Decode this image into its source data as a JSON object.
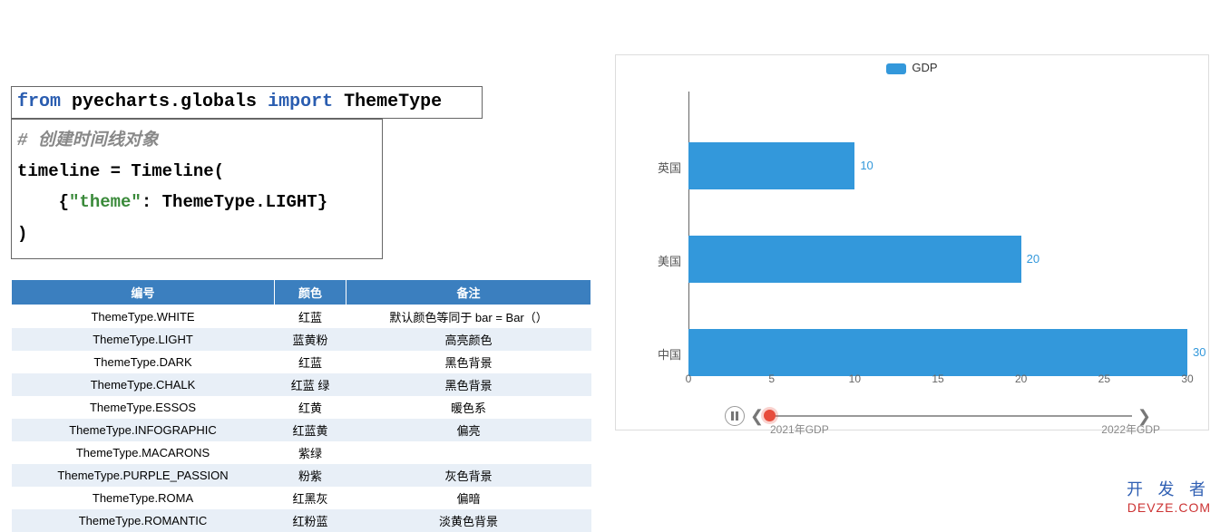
{
  "code1": {
    "kw_from": "from",
    "mod": " pyecharts.globals ",
    "kw_import": "import",
    "cls": " ThemeType"
  },
  "code2": {
    "comment": "# 创建时间线对象",
    "line1": "timeline = Timeline(",
    "indent": "    ",
    "brace_open": "{",
    "theme_key": "\"theme\"",
    "colon": ": ThemeType.LIGHT",
    "brace_close": "}",
    "line3": ")"
  },
  "table": {
    "headers": [
      "编号",
      "颜色",
      "备注"
    ],
    "rows": [
      [
        "ThemeType.WHITE",
        "红蓝",
        "默认颜色等同于 bar = Bar（）"
      ],
      [
        "ThemeType.LIGHT",
        "蓝黄粉",
        "高亮颜色"
      ],
      [
        "ThemeType.DARK",
        "红蓝",
        "黑色背景"
      ],
      [
        "ThemeType.CHALK",
        "红蓝 绿",
        "黑色背景"
      ],
      [
        "ThemeType.ESSOS",
        "红黄",
        "暖色系"
      ],
      [
        "ThemeType.INFOGRAPHIC",
        "红蓝黄",
        "偏亮"
      ],
      [
        "ThemeType.MACARONS",
        "紫绿",
        ""
      ],
      [
        "ThemeType.PURPLE_PASSION",
        "粉紫",
        "灰色背景"
      ],
      [
        "ThemeType.ROMA",
        "红黑灰",
        "偏暗"
      ],
      [
        "ThemeType.ROMANTIC",
        "红粉蓝",
        "淡黄色背景"
      ]
    ]
  },
  "chart_data": {
    "type": "bar",
    "orientation": "horizontal",
    "categories": [
      "英国",
      "美国",
      "中国"
    ],
    "series": [
      {
        "name": "GDP",
        "values": [
          10,
          20,
          30
        ]
      }
    ],
    "xlabel": "",
    "ylabel": "",
    "xlim": [
      0,
      30
    ],
    "x_ticks": [
      0,
      5,
      10,
      15,
      20,
      25,
      30
    ],
    "timeline": {
      "play_state": "paused",
      "points": [
        "2021年GDP",
        "2022年GDP"
      ],
      "current_index": 0
    },
    "legend": {
      "items": [
        "GDP"
      ]
    }
  },
  "watermark": {
    "main": "开 发 者",
    "sub": "DEVZE.COM"
  }
}
